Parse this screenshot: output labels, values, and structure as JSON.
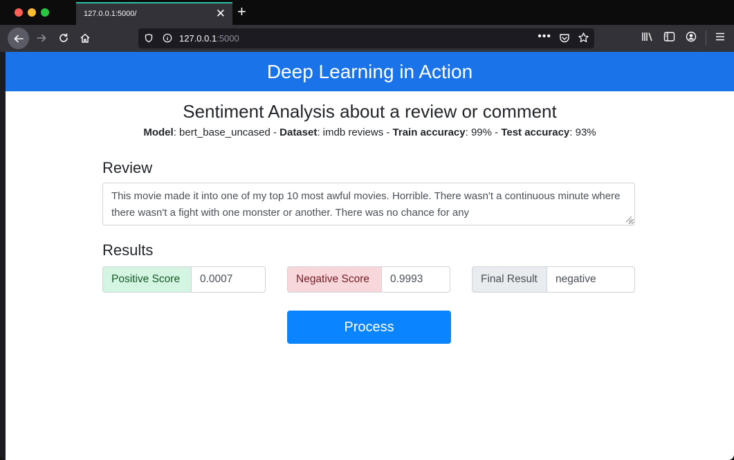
{
  "browser": {
    "tab_title": "127.0.0.1:5000/",
    "tab_close": "✕",
    "new_tab": "+",
    "url_host": "127.0.0.1",
    "url_port": ":5000",
    "url_more": "•••"
  },
  "page": {
    "header": "Deep Learning in Action",
    "title": "Sentiment Analysis about a review or comment",
    "model_label": "Model",
    "model_value": ": bert_base_uncased - ",
    "dataset_label": "Dataset",
    "dataset_value": ": imdb reviews - ",
    "train_label": "Train accuracy",
    "train_value": ": 99% - ",
    "test_label": "Test accuracy",
    "test_value": ": 93%",
    "review_label": "Review",
    "review_text": "This movie made it into one of my top 10 most awful movies. Horrible. There wasn't a continuous minute where there wasn't a fight with one monster or another. There was no chance for any",
    "results_label": "Results",
    "positive_label": "Positive Score",
    "positive_value": "0.0007",
    "negative_label": "Negative Score",
    "negative_value": "0.9993",
    "final_label": "Final Result",
    "final_value": "negative",
    "process_button": "Process"
  },
  "colors": {
    "header_bg": "#1a73e8",
    "button_bg": "#0a84ff",
    "positive_bg": "#d4f5e2",
    "negative_bg": "#f8d7da",
    "final_bg": "#e9ecef"
  }
}
